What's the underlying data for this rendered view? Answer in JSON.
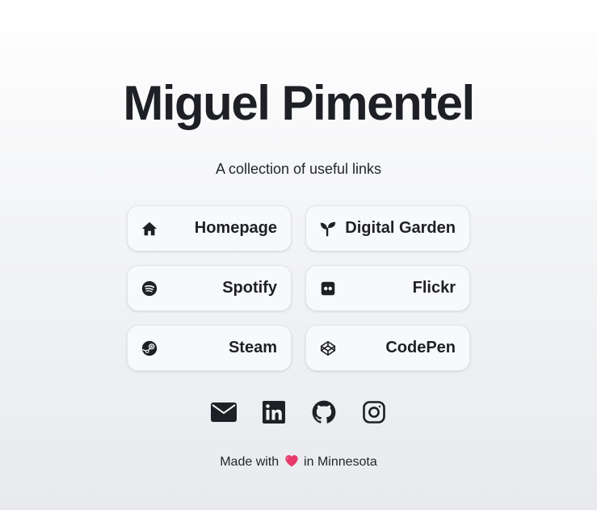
{
  "header": {
    "title": "Miguel Pimentel",
    "subtitle": "A collection of useful links"
  },
  "links": [
    {
      "label": "Homepage",
      "icon": "home-icon"
    },
    {
      "label": "Digital Garden",
      "icon": "sprout-icon"
    },
    {
      "label": "Spotify",
      "icon": "spotify-icon"
    },
    {
      "label": "Flickr",
      "icon": "flickr-icon"
    },
    {
      "label": "Steam",
      "icon": "steam-icon"
    },
    {
      "label": "CodePen",
      "icon": "codepen-icon"
    }
  ],
  "social": [
    {
      "icon": "mail-icon"
    },
    {
      "icon": "linkedin-icon"
    },
    {
      "icon": "github-icon"
    },
    {
      "icon": "instagram-icon"
    }
  ],
  "footer": {
    "prefix": "Made with",
    "heart_icon": "heart-icon",
    "suffix": "in Minnesota"
  },
  "colors": {
    "text": "#1e2025",
    "card_bg": "#f8f9fa",
    "heart": "#e8396b"
  }
}
